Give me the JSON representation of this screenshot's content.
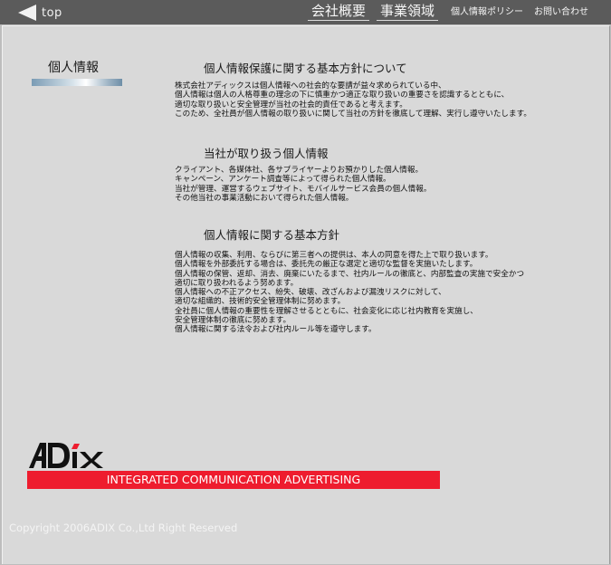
{
  "topbar": {
    "back_label": "top",
    "nav": [
      {
        "label": "会社概要"
      },
      {
        "label": "事業領域"
      }
    ],
    "links": [
      {
        "label": "個人情報ポリシー"
      },
      {
        "label": "お問い合わせ"
      }
    ]
  },
  "sidebar": {
    "title": "個人情報"
  },
  "sections": [
    {
      "heading": "個人情報保護に関する基本方針について",
      "lines": [
        "株式会社アディックスは個人情報への社会的な要請が益々求められている中、",
        "個人情報は個人の人格尊重の理念の下に慎重かつ適正な取り扱いの重要さを認識するとともに、",
        "適切な取り扱いと安全管理が当社の社会的責任であると考えます。",
        "このため、全社員が個人情報の取り扱いに関して当社の方針を徹底して理解、実行し遵守いたします。"
      ]
    },
    {
      "heading": "当社が取り扱う個人情報",
      "lines": [
        "クライアント、各媒体社、各サプライヤーよりお預かりした個人情報。",
        "キャンペーン、アンケート調査等によって得られた個人情報。",
        "当社が管理、運営するウェブサイト、モバイルサービス会員の個人情報。",
        "その他当社の事業活動において得られた個人情報。"
      ]
    },
    {
      "heading": "個人情報に関する基本方針",
      "lines": [
        "個人情報の収集、利用、ならびに第三者への提供は、本人の同意を得た上で取り扱います。",
        "個人情報を外部委託する場合は、委託先の厳正な選定と適切な監督を実施いたします。",
        "個人情報の保管、返却、消去、廃棄にいたるまで、社内ルールの徹底と、内部監査の実施で安全かつ",
        "適切に取り扱われるよう努めます。",
        "個人情報への不正アクセス、紛失、破壊、改ざんおよび漏洩リスクに対して、",
        "適切な組織的、技術的安全管理体制に努めます。",
        "全社員に個人情報の重要性を理解させるとともに、社会変化に応じ社内教育を実施し、",
        "安全管理体制の徹底に努めます。",
        "個人情報に関する法令および社内ルール等を遵守します。"
      ]
    }
  ],
  "logo": {
    "text": "ADiX",
    "icon": "adix-logo"
  },
  "tagline": "INTEGRATED COMMUNICATION ADVERTISING",
  "copyright": "Copyright 2006ADIX Co.,Ltd Right Reserved",
  "colors": {
    "topbar": "#5b5b5b",
    "panel": "#d9d9d9",
    "accent_red": "#ee1c2e"
  }
}
